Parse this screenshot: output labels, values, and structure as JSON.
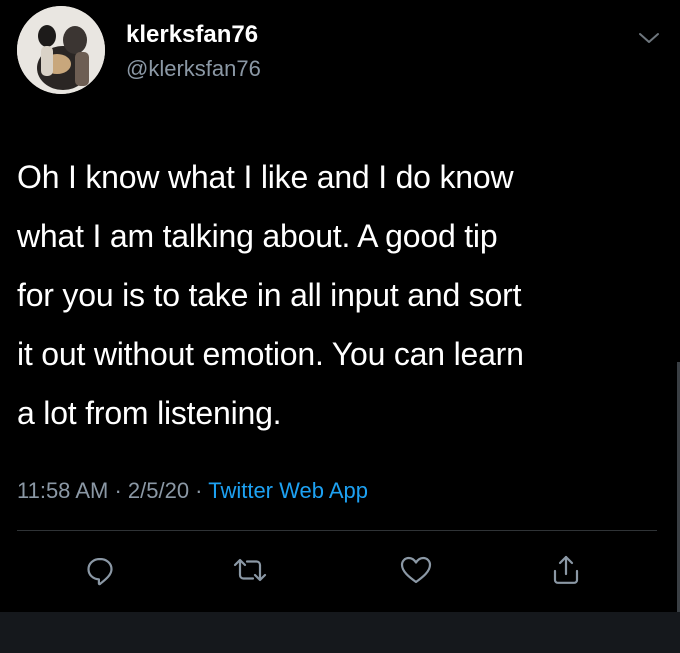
{
  "user": {
    "display_name": "klerksfan76",
    "handle": "@klerksfan76",
    "avatar_icon": "profile-photo"
  },
  "tweet": {
    "lines": [
      "Oh I know what I like and I do know",
      "what I am talking about. A good tip",
      "for you is to take in all input and sort",
      "it out without emotion. You can learn",
      "a lot from listening."
    ],
    "time": "11:58 AM",
    "separator": " · ",
    "date": "2/5/20",
    "source": "Twitter Web App"
  },
  "actions": {
    "reply_icon": "reply-icon",
    "retweet_icon": "retweet-icon",
    "like_icon": "like-icon",
    "share_icon": "share-icon"
  },
  "colors": {
    "background": "#000000",
    "text": "#ffffff",
    "secondary": "#8b98a5",
    "accent": "#1da1f2"
  }
}
